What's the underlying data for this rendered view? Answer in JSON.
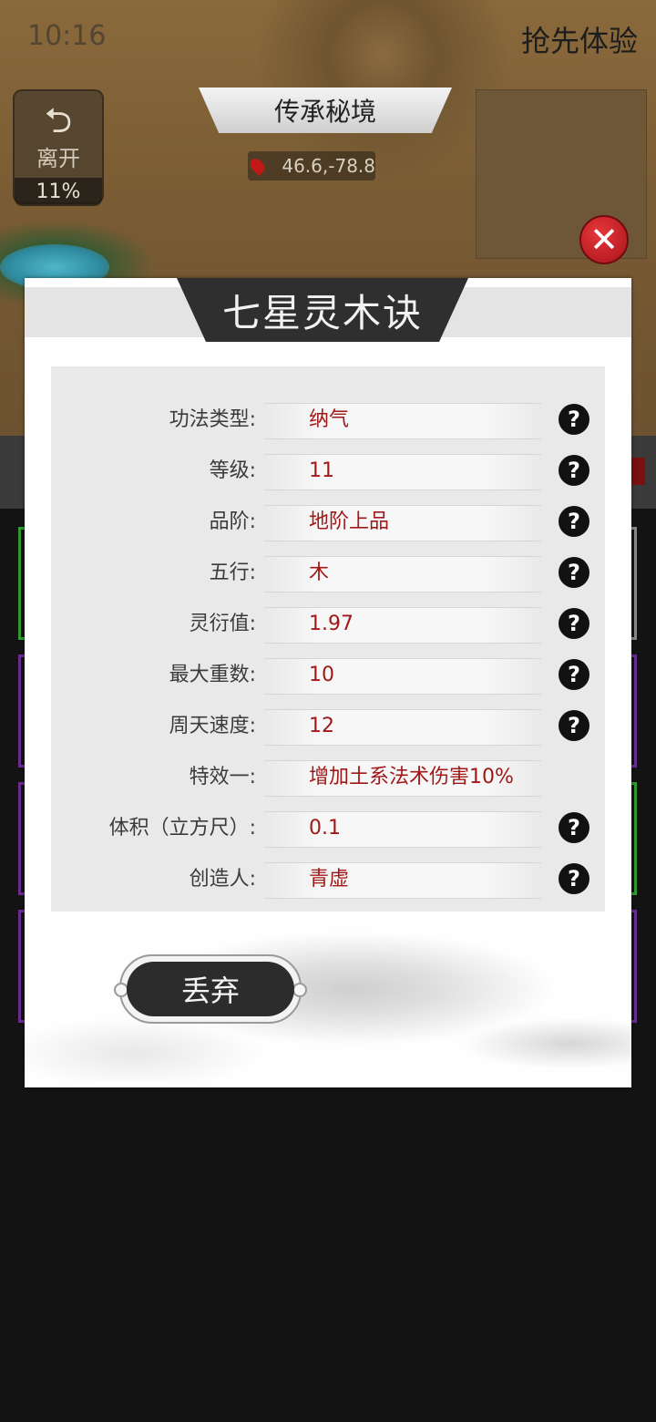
{
  "status_bar": {
    "time": "10:16",
    "right_label": "抢先体验"
  },
  "hud": {
    "leave_button": {
      "label": "离开",
      "progress_text": "11%"
    },
    "location_title": "传承秘境",
    "coordinates": "46.6,-78.8"
  },
  "modal": {
    "title": "七星灵木诀",
    "attributes": [
      {
        "label": "功法类型:",
        "value": "纳气",
        "has_help": true
      },
      {
        "label": "等级:",
        "value": "11",
        "has_help": true
      },
      {
        "label": "品阶:",
        "value": "地阶上品",
        "has_help": true
      },
      {
        "label": "五行:",
        "value": "木",
        "has_help": true
      },
      {
        "label": "灵衍值:",
        "value": "1.97",
        "has_help": true
      },
      {
        "label": "最大重数:",
        "value": "10",
        "has_help": true
      },
      {
        "label": "周天速度:",
        "value": "12",
        "has_help": true
      },
      {
        "label": "特效一:",
        "value": "增加土系法术伤害10%",
        "has_help": false
      },
      {
        "label": "体积（立方尺）:",
        "value": "0.1",
        "has_help": true
      },
      {
        "label": "创造人:",
        "value": "青虚",
        "has_help": true
      }
    ],
    "discard_label": "丢弃",
    "help_glyph": "?"
  },
  "colors": {
    "value_text": "#a01919",
    "title_tab": "#2f2f2f",
    "close_button": "#c8141a"
  }
}
